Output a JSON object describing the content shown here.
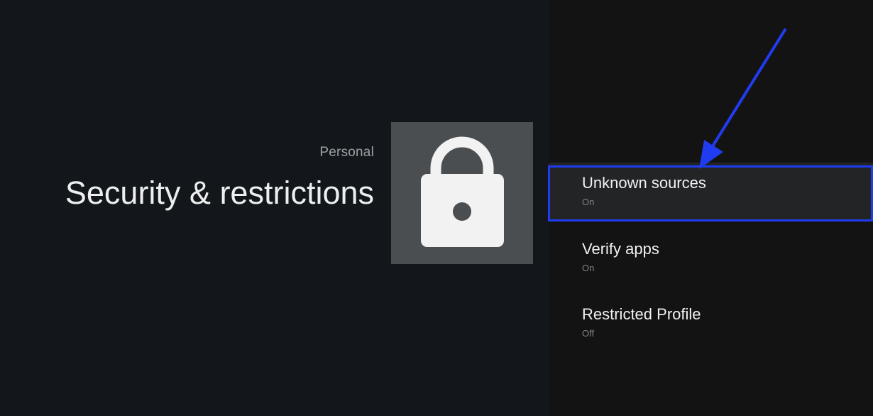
{
  "header": {
    "section": "Personal",
    "title": "Security & restrictions"
  },
  "icon": {
    "name": "lock-icon"
  },
  "settings": {
    "items": [
      {
        "title": "Unknown sources",
        "status": "On"
      },
      {
        "title": "Verify apps",
        "status": "On"
      },
      {
        "title": "Restricted Profile",
        "status": "Off"
      }
    ]
  },
  "colors": {
    "background_left": "#13171b",
    "background_right": "#131313",
    "icon_tile": "#4b4e50",
    "selected_row": "#222426",
    "annotation_blue": "#1f3cf0"
  }
}
